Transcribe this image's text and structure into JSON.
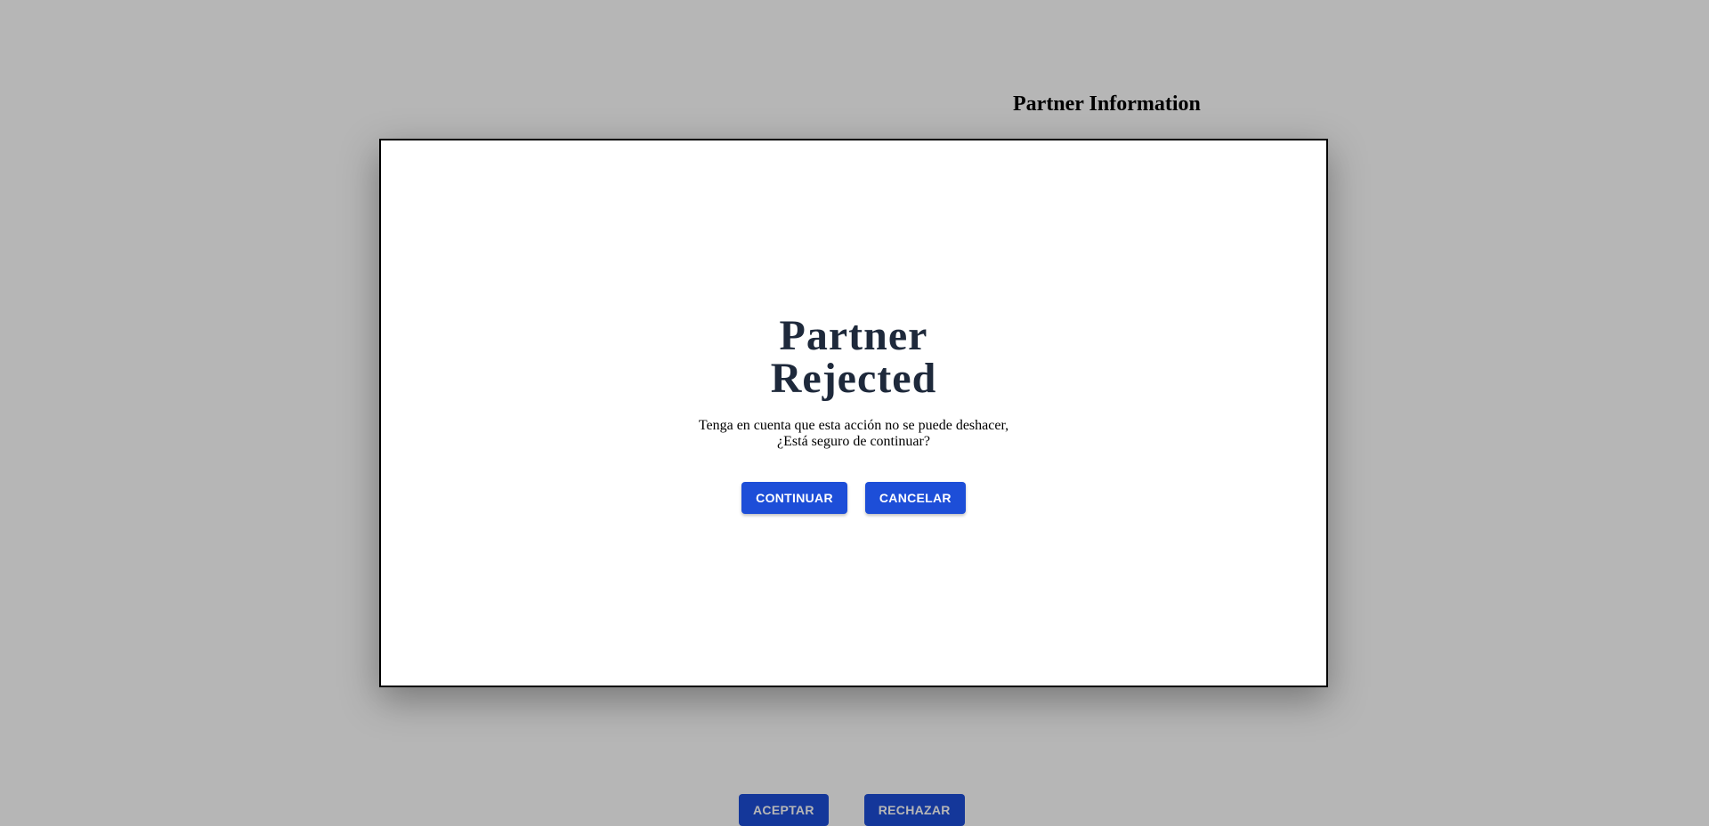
{
  "page": {
    "title": "Partner Information",
    "actions": {
      "accept_label": "ACEPTAR",
      "reject_label": "RECHAZAR"
    }
  },
  "modal": {
    "title": "Partner Rejected",
    "message": "Tenga en cuenta que esta acción no se puede deshacer, ¿Está seguro de continuar?",
    "continue_label": "CONTINUAR",
    "cancel_label": "CANCELAR"
  },
  "colors": {
    "primary_button": "#1d4ed8",
    "modal_title": "#1e293b",
    "backdrop": "#b7b7b7"
  }
}
